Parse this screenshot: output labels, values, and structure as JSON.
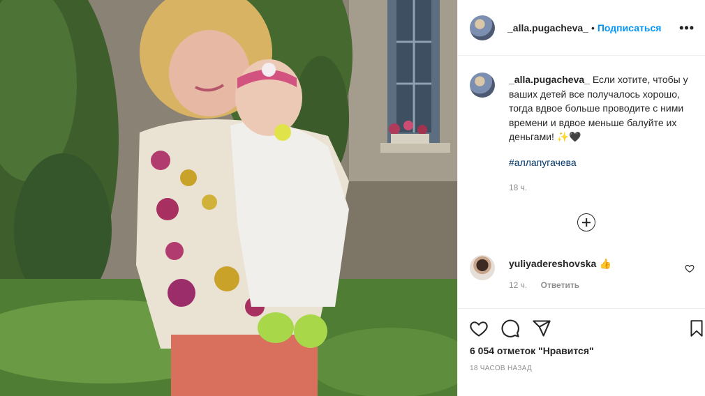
{
  "post": {
    "photo_alt": "",
    "author": {
      "username": "_alla.pugacheva_",
      "avatar_icon": "profile-avatar"
    },
    "header": {
      "separator": "•",
      "follow_label": "Подписаться",
      "more_label": "•••"
    },
    "caption": {
      "username": "_alla.pugacheva_",
      "text": "Если хотите, чтобы у ваших детей все получалось хорошо, тогда вдвое больше проводите с ними времени и вдвое меньше балуйте их деньгами! ✨🖤",
      "hashtag": "#аллапугачева",
      "time": "18 ч."
    },
    "comments": [
      {
        "username": "yuliyadereshovska",
        "text": "👍",
        "time": "12 ч.",
        "reply_label": "Ответить"
      }
    ],
    "likes_text": "6 054 отметок \"Нравится\"",
    "date_text": "18 ЧАСОВ НАЗАД"
  },
  "colors": {
    "link_blue": "#0095f6",
    "hashtag_blue": "#00376b",
    "muted": "#8e8e8e",
    "text": "#262626"
  }
}
